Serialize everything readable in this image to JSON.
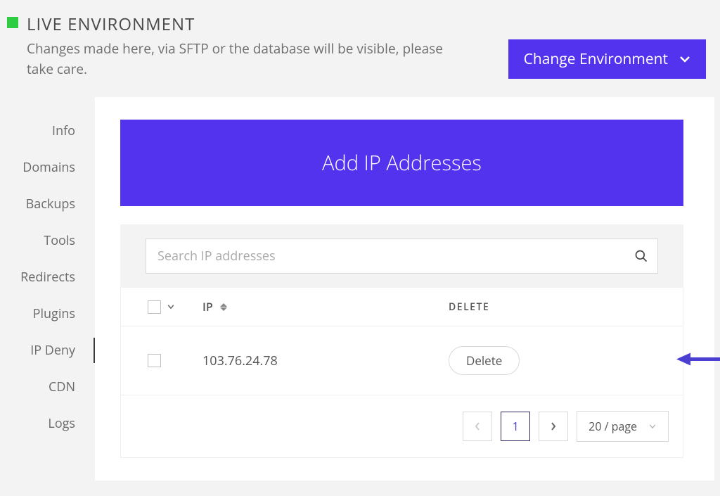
{
  "header": {
    "env_title": "LIVE ENVIRONMENT",
    "env_sub": "Changes made here, via SFTP or the database will be visible, please take care.",
    "change_env_label": "Change Environment"
  },
  "sidebar": {
    "items": [
      {
        "label": "Info"
      },
      {
        "label": "Domains"
      },
      {
        "label": "Backups"
      },
      {
        "label": "Tools"
      },
      {
        "label": "Redirects"
      },
      {
        "label": "Plugins"
      },
      {
        "label": "IP Deny"
      },
      {
        "label": "CDN"
      },
      {
        "label": "Logs"
      }
    ],
    "active_index": 6
  },
  "main": {
    "add_banner": "Add IP Addresses",
    "search_placeholder": "Search IP addresses",
    "columns": {
      "ip": "IP",
      "delete": "DELETE"
    },
    "rows": [
      {
        "ip": "103.76.24.78",
        "delete_label": "Delete"
      }
    ],
    "pagination": {
      "current": "1",
      "page_size_label": "20 / page"
    }
  },
  "colors": {
    "accent": "#5333ed"
  }
}
